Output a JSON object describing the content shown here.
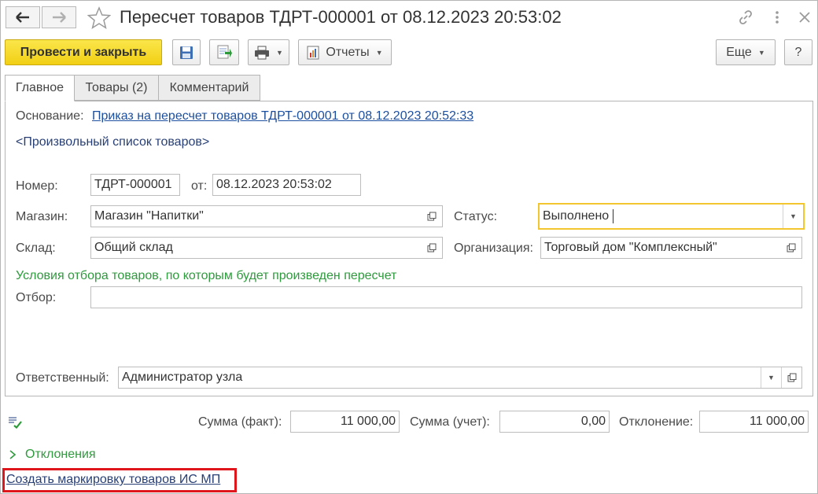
{
  "window": {
    "title": "Пересчет товаров ТДРТ-000001 от 08.12.2023 20:53:02"
  },
  "icons": {
    "back": "arrow-left-icon",
    "forward": "arrow-right-icon",
    "favorite": "star-icon",
    "link": "chain-link-icon",
    "menu": "kebab-menu-icon",
    "close": "close-icon",
    "save": "floppy-disk-icon",
    "post": "document-post-icon",
    "print": "printer-icon",
    "reports": "report-icon",
    "open": "open-form-icon",
    "history": "edit-history-icon",
    "expand": "chevron-right-icon"
  },
  "toolbar": {
    "post_close_label": "Провести и закрыть",
    "reports_label": "Отчеты",
    "more_label": "Еще",
    "help_label": "?"
  },
  "tabs": [
    {
      "label": "Главное",
      "active": true
    },
    {
      "label": "Товары (2)",
      "active": false
    },
    {
      "label": "Комментарий",
      "active": false
    }
  ],
  "main": {
    "basis_label": "Основание:",
    "basis_link": "Приказ на пересчет товаров ТДРТ-000001 от 08.12.2023 20:52:33",
    "arbitrary_list": "<Произвольный список товаров>",
    "number_label": "Номер:",
    "number_value": "ТДРТ-000001",
    "date_label": "от:",
    "date_value": "08.12.2023 20:53:02",
    "store_label": "Магазин:",
    "store_value": "Магазин \"Напитки\"",
    "status_label": "Статус:",
    "status_value": "Выполнено",
    "warehouse_label": "Склад:",
    "warehouse_value": "Общий склад",
    "org_label": "Организация:",
    "org_value": "Торговый дом \"Комплексный\"",
    "filter_heading": "Условия отбора товаров, по которым будет произведен пересчет",
    "filter_label": "Отбор:",
    "filter_value": "",
    "responsible_label": "Ответственный:",
    "responsible_value": "Администратор узла"
  },
  "totals": {
    "fact_label": "Сумма (факт):",
    "fact_value": "11 000,00",
    "account_label": "Сумма (учет):",
    "account_value": "0,00",
    "deviation_label": "Отклонение:",
    "deviation_value": "11 000,00"
  },
  "footer": {
    "deviations_label": "Отклонения",
    "create_marking_link": "Создать маркировку товаров ИС МП"
  },
  "colors": {
    "primary_button": "#f4d52a",
    "link": "#1c4fa0",
    "green_text": "#2f9a3d",
    "focus_border": "#f3c52e",
    "highlight": "#e0161d"
  }
}
